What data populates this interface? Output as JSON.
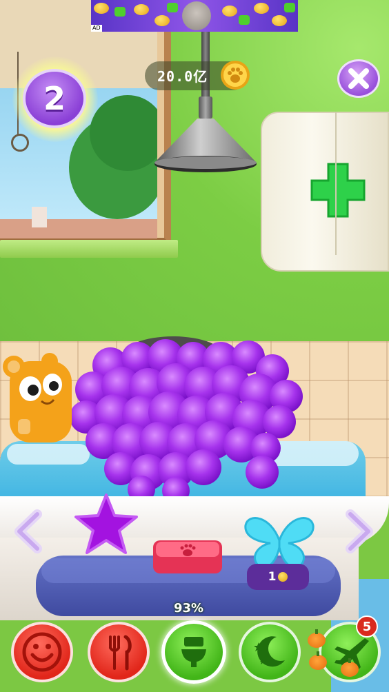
{
  "ad": {
    "label": "AD"
  },
  "hud": {
    "level": "2",
    "coins": "20.0亿"
  },
  "shop": {
    "items": [
      {
        "name": "star"
      },
      {
        "name": "soap"
      },
      {
        "name": "butterfly",
        "price": "1"
      }
    ]
  },
  "progress": {
    "label": "93%",
    "value": 0.93
  },
  "nav": {
    "buttons": [
      "happiness",
      "food",
      "hygiene",
      "sleep",
      "travel"
    ],
    "travel_badge": "5"
  },
  "colors": {
    "wall": "#7ccd44",
    "foam": "#a431e8",
    "accent_purple": "#8a3fd6",
    "red_button": "#e1261a",
    "green_button": "#42b518"
  }
}
